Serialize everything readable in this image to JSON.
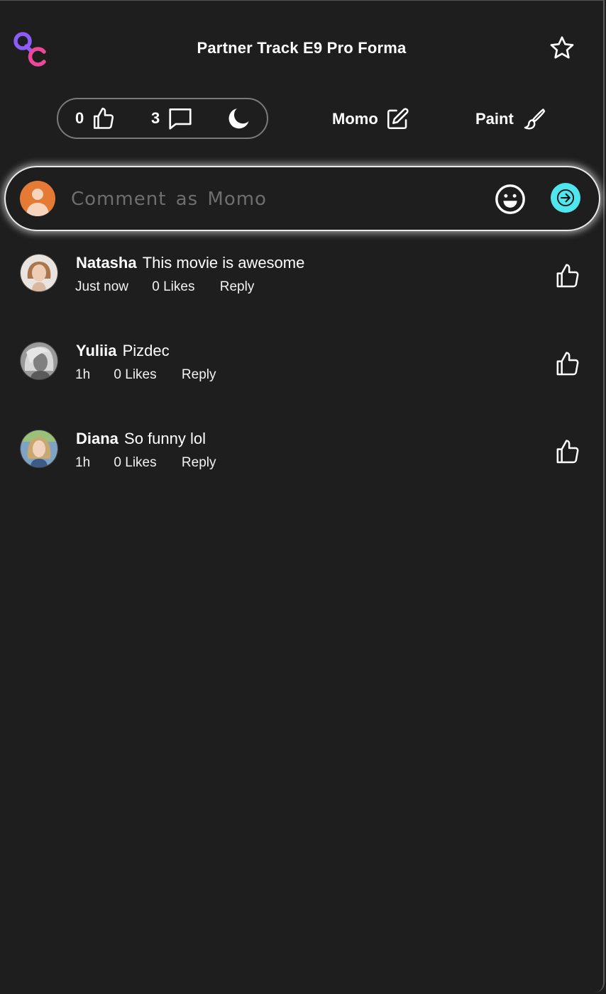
{
  "header": {
    "logo_icon": "qc-logo-icon",
    "title": "Partner Track E9 Pro Forma",
    "favorite_icon": "star-icon"
  },
  "toolbar": {
    "likes_count": "0",
    "comments_count": "3",
    "icons": [
      "thumbs-up-icon",
      "comment-icon",
      "moon-icon",
      "edit-icon",
      "brush-icon"
    ],
    "momo_label": "Momo",
    "paint_label": "Paint"
  },
  "composer": {
    "placeholder": "Comment as Momo",
    "value": "",
    "avatar_color": "#e57a35",
    "send_color": "#4fe6ee"
  },
  "comments": [
    {
      "author": "Natasha",
      "text": "This movie is awesome",
      "time": "Just now",
      "likes": "0 Likes",
      "reply": "Reply"
    },
    {
      "author": "Yuliia",
      "text": "Pizdec",
      "time": "1h",
      "likes": "0 Likes",
      "reply": "Reply"
    },
    {
      "author": "Diana",
      "text": "So funny lol",
      "time": "1h",
      "likes": "0 Likes",
      "reply": "Reply"
    }
  ],
  "colors": {
    "background": "#1e1e1e",
    "logo_purple": "#8b5cf6",
    "logo_pink": "#ec4899"
  }
}
